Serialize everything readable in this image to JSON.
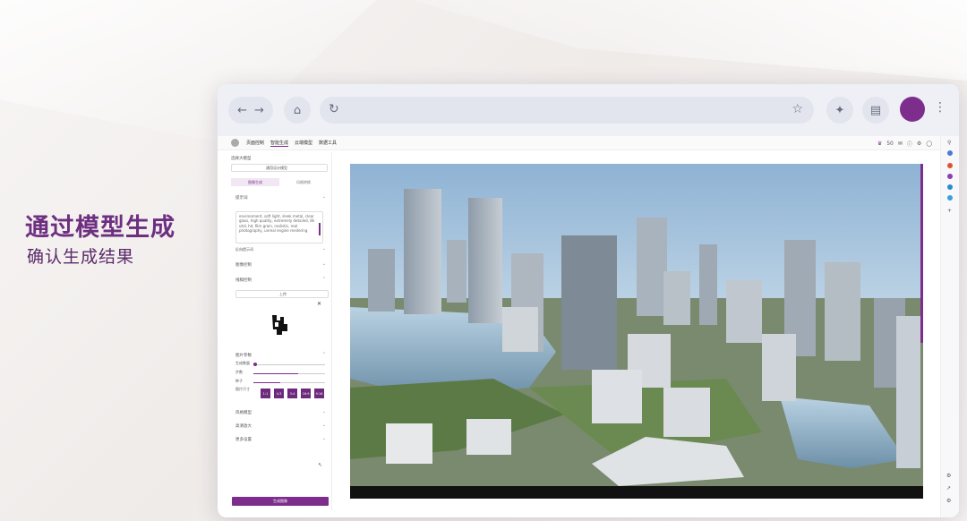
{
  "slide": {
    "title": "通过模型生成",
    "subtitle": "确认生成结果"
  },
  "browser": {
    "icons": [
      "back-arrow-icon",
      "forward-arrow-icon",
      "home-icon",
      "reload-icon",
      "bookmark-star-icon",
      "extension-icon",
      "reading-list-icon",
      "profile-avatar",
      "more-menu-icon"
    ],
    "colors": {
      "accent": "#7d2e8c",
      "toolbar": "#eef0f6"
    }
  },
  "app": {
    "tabs": [
      "页面控制",
      "智能生成",
      "云端模型",
      "数据工具"
    ],
    "status_count": "50",
    "left_panel": {
      "model_label": "选择大模型",
      "model_value": "通用设计模型",
      "mode_tabs": [
        "图像生成",
        "风格转换"
      ],
      "prompt_section": "提示词",
      "prompt_text": "environment, soft light, sleek metal, clear glass, high quality, extremely detailed, 8k uhd, hd, film grain, realistic, real photography, unreal engine rendering",
      "negative_section": "反向提示词",
      "image_control": "图像控制",
      "line_control": "线稿控制",
      "upload_button": "上传",
      "settings_section": "图片参数",
      "param1": "生成数量",
      "param2": "步数",
      "param3": "种子",
      "param4": "图片尺寸",
      "sizes": [
        "1:1",
        "4:3",
        "3:4",
        "16:9",
        "9:16"
      ],
      "extra1": "风格模型",
      "extra2": "高清放大",
      "extra3": "更多设置",
      "generate_button": "生成图像"
    }
  }
}
